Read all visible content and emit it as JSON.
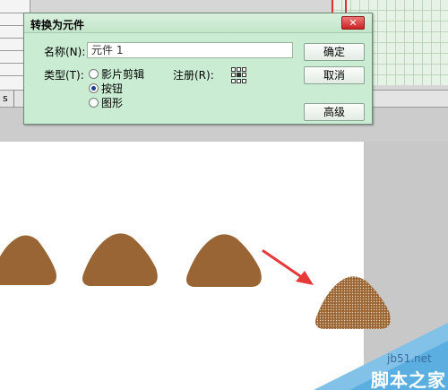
{
  "timeline": {
    "label": "s"
  },
  "dialog": {
    "title": "转换为元件",
    "close_glyph": "✕",
    "name_label": "名称(N):",
    "name_value": "元件 1",
    "type_label": "类型(T):",
    "type_options": [
      "影片剪辑",
      "按钮",
      "图形"
    ],
    "selected_type": "按钮",
    "registration_label": "注册(R):",
    "buttons": {
      "ok": "确定",
      "cancel": "取消",
      "advanced": "高级"
    }
  },
  "stage": {
    "shape_color": "#9a6535",
    "selected_shape_pattern": "dotted",
    "arrow_color": "#e8393a"
  },
  "watermark": {
    "domain": "jb51.net",
    "name": "脚本之家",
    "color": "#5aaee0"
  }
}
